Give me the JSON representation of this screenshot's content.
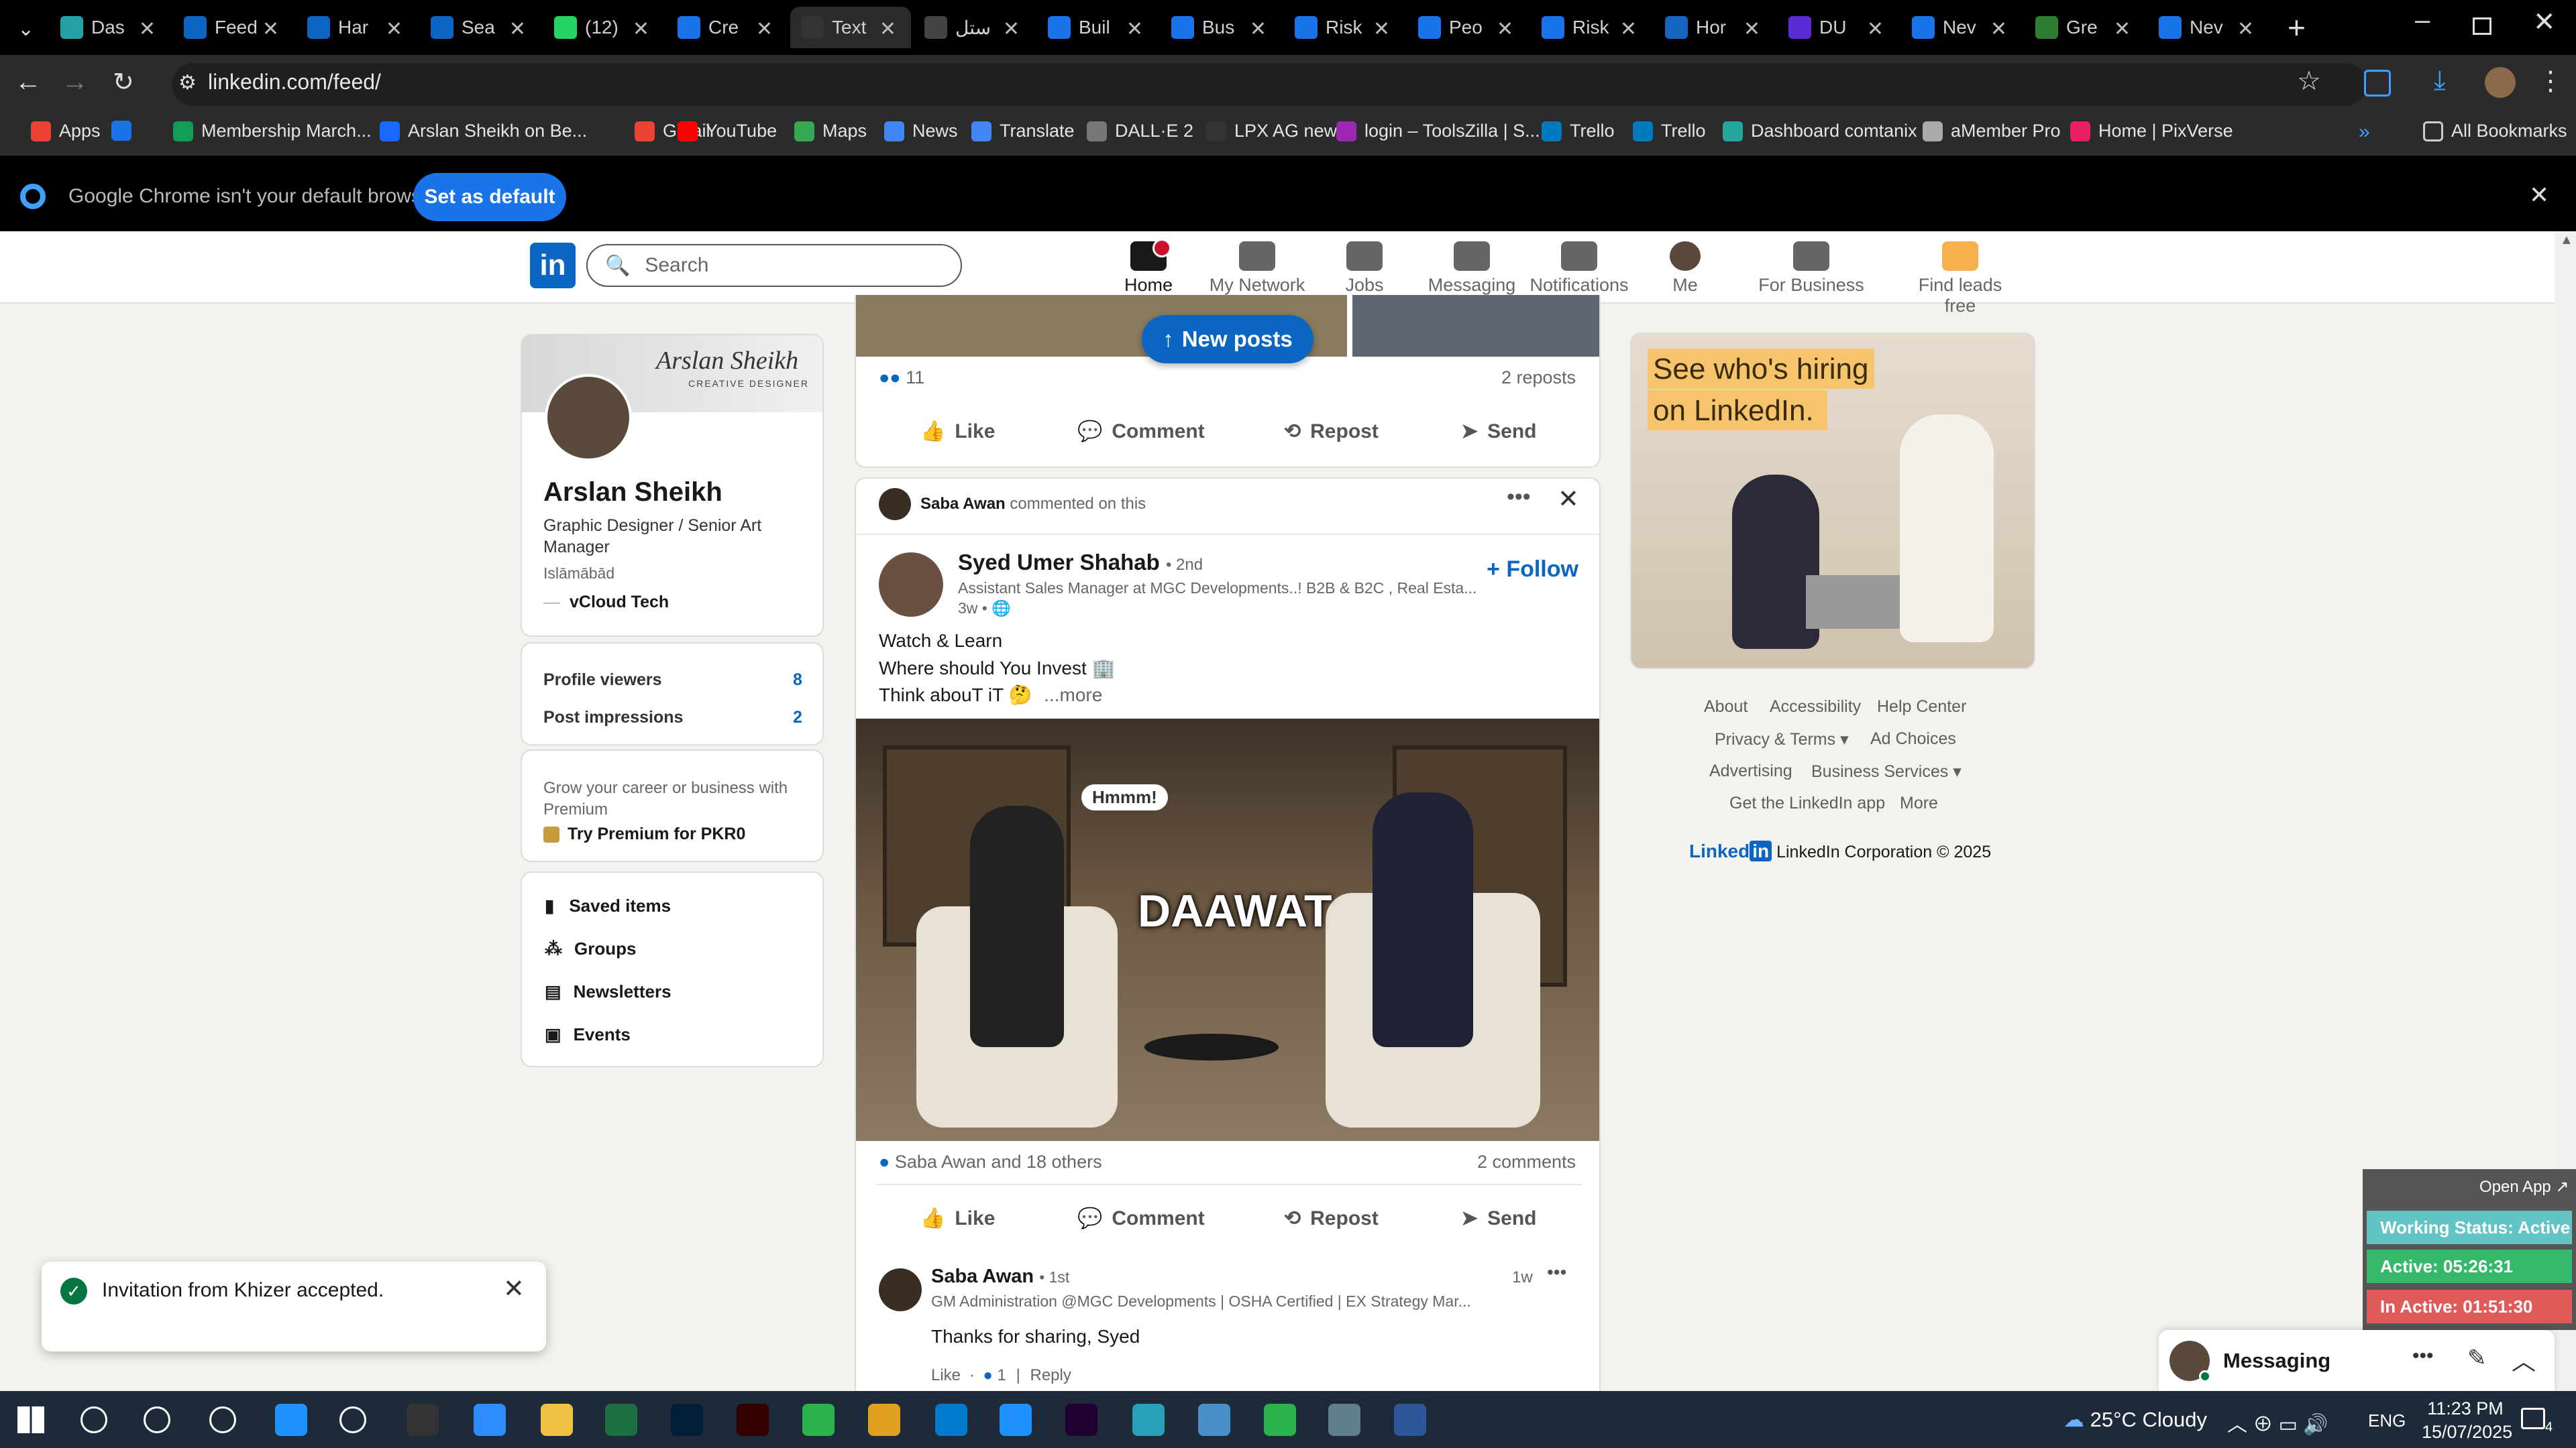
{
  "browser": {
    "tabs": [
      {
        "label": "Das",
        "icon": "teal-app-icon",
        "color": "#25a1a6"
      },
      {
        "label": "Feed",
        "icon": "linkedin-icon",
        "color": "#0a66c2"
      },
      {
        "label": "Har",
        "icon": "linkedin-icon",
        "color": "#0a66c2"
      },
      {
        "label": "Sea",
        "icon": "linkedin-icon",
        "color": "#0a66c2"
      },
      {
        "label": "(12)",
        "icon": "whatsapp-icon",
        "color": "#25d366"
      },
      {
        "label": "Cre",
        "icon": "document-icon",
        "color": "#1a73e8"
      },
      {
        "label": "Text",
        "icon": "pause-icon",
        "color": "#333333"
      },
      {
        "label": "ستل",
        "icon": "openai-icon",
        "color": "#444444"
      },
      {
        "label": "Buil",
        "icon": "document-icon",
        "color": "#1a73e8"
      },
      {
        "label": "Bus",
        "icon": "document-icon",
        "color": "#1a73e8"
      },
      {
        "label": "Risk",
        "icon": "document-icon",
        "color": "#1a73e8"
      },
      {
        "label": "Peo",
        "icon": "document-icon",
        "color": "#1a73e8"
      },
      {
        "label": "Risk",
        "icon": "document-icon",
        "color": "#1a73e8"
      },
      {
        "label": "Hor",
        "icon": "blue-circle-icon",
        "color": "#1565c0"
      },
      {
        "label": "DU",
        "icon": "video-icon",
        "color": "#5b2bd6"
      },
      {
        "label": "Nev",
        "icon": "globe-icon",
        "color": "#1a73e8"
      },
      {
        "label": "Gre",
        "icon": "palm-icon",
        "color": "#2e7d32"
      },
      {
        "label": "Nev",
        "icon": "globe-icon",
        "color": "#1a73e8"
      }
    ],
    "url": "linkedin.com/feed/",
    "bookmarks": [
      {
        "label": "Apps",
        "color": "#ea4335"
      },
      {
        "label": "",
        "color": "#1a73e8"
      },
      {
        "label": "Membership March...",
        "color": "#0f9d58"
      },
      {
        "label": "Arslan Sheikh on Be...",
        "color": "#1769ff"
      },
      {
        "label": "Gmail",
        "color": "#ea4335"
      },
      {
        "label": "YouTube",
        "color": "#ff0000"
      },
      {
        "label": "Maps",
        "color": "#34a853"
      },
      {
        "label": "News",
        "color": "#4285f4"
      },
      {
        "label": "Translate",
        "color": "#4285f4"
      },
      {
        "label": "DALL·E 2",
        "color": "#777777"
      },
      {
        "label": "LPX AG new",
        "color": "#333333"
      },
      {
        "label": "login – ToolsZilla | S...",
        "color": "#9c27b0"
      },
      {
        "label": "Trello",
        "color": "#0079bf"
      },
      {
        "label": "Trello",
        "color": "#0079bf"
      },
      {
        "label": "Dashboard comtanix",
        "color": "#26a69a"
      },
      {
        "label": "aMember Pro",
        "color": "#aaaaaa"
      },
      {
        "label": "Home | PixVerse",
        "color": "#e91e63"
      }
    ],
    "all_bookmarks": "All Bookmarks",
    "infobar": {
      "text": "Google Chrome isn't your default browser",
      "button": "Set as default"
    }
  },
  "linkedin": {
    "search_placeholder": "Search",
    "nav": [
      {
        "label": "Home",
        "icon": "home-icon",
        "active": true
      },
      {
        "label": "My Network",
        "icon": "network-icon"
      },
      {
        "label": "Jobs",
        "icon": "jobs-icon"
      },
      {
        "label": "Messaging",
        "icon": "messaging-icon"
      },
      {
        "label": "Notifications",
        "icon": "bell-icon"
      },
      {
        "label": "Me",
        "icon": "avatar-icon"
      },
      {
        "label": "For Business",
        "icon": "grid-icon"
      },
      {
        "label": "Find leads free",
        "icon": "leads-icon"
      }
    ],
    "profile": {
      "banner_text": "Arslan Sheikh",
      "banner_sub": "CREATIVE DESIGNER",
      "name": "Arslan Sheikh",
      "headline": "Graphic Designer / Senior Art Manager",
      "location": "Islāmābād",
      "company": "vCloud Tech",
      "stats": [
        {
          "label": "Profile viewers",
          "value": "8"
        },
        {
          "label": "Post impressions",
          "value": "2"
        }
      ],
      "premium_text": "Grow your career or business with Premium",
      "premium_link": "Try Premium for PKR0",
      "links": [
        "Saved items",
        "Groups",
        "Newsletters",
        "Events"
      ]
    },
    "feed": {
      "new_posts": "New posts",
      "post1": {
        "reactions": "11",
        "reposts": "2 reposts"
      },
      "actions": [
        "Like",
        "Comment",
        "Repost",
        "Send"
      ],
      "post2": {
        "context_name": "Saba Awan",
        "context_text": "commented on this",
        "author": "Syed Umer Shahab",
        "degree": "• 2nd",
        "subtitle": "Assistant Sales Manager at MGC Developments..! B2B & B2C , Real Esta...",
        "time": "3w •",
        "follow": "Follow",
        "text": [
          "Watch & Learn",
          "Where should You Invest 🏢",
          "Think abouT iT 🤔"
        ],
        "more": "...more",
        "image_overlay": "DAAWAT",
        "bubble": "Hmmm!",
        "reactions": "Saba Awan and 18 others",
        "comments": "2 comments"
      },
      "comment": {
        "name": "Saba Awan",
        "degree": "• 1st",
        "subtitle": "GM Administration @MGC Developments | OSHA Certified | EX Strategy Mar...",
        "time": "1w",
        "text": "Thanks for sharing, Syed",
        "like": "Like",
        "like_count": "1",
        "reply": "Reply"
      }
    },
    "ad": {
      "line1": "See who's hiring",
      "line2": "on LinkedIn."
    },
    "footer": [
      [
        "About",
        "Accessibility",
        "Help Center"
      ],
      [
        "Privacy & Terms",
        "Ad Choices"
      ],
      [
        "Advertising",
        "Business Services"
      ],
      [
        "Get the LinkedIn app",
        "More"
      ]
    ],
    "copyright": "LinkedIn Corporation © 2025",
    "toast": "Invitation from Khizer accepted.",
    "messaging": "Messaging"
  },
  "timer_widget": {
    "open_app": "Open App ↗",
    "status": "Working Status: Active",
    "active": "Active: 05:26:31",
    "inactive": "In Active: 01:51:30"
  },
  "taskbar": {
    "weather": "25°C Cloudy",
    "lang": "ENG",
    "time": "11:23 PM",
    "date": "15/07/2025",
    "notif_count": "4"
  }
}
